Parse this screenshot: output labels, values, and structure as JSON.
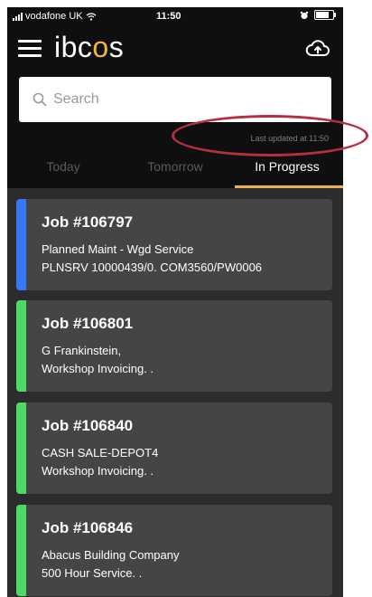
{
  "status_bar": {
    "carrier": "vodafone UK",
    "time": "11:50"
  },
  "header": {
    "brand_prefix": "ibc",
    "brand_accent": "o",
    "brand_suffix": "s",
    "accent_color": "#f0b63f",
    "menu_icon": "hamburger-menu-icon",
    "upload_icon": "cloud-upload-icon"
  },
  "search": {
    "placeholder": "Search",
    "value": ""
  },
  "last_updated": "Last updated at 11:50",
  "tabs": [
    {
      "label": "Today",
      "active": false
    },
    {
      "label": "Tomorrow",
      "active": false
    },
    {
      "label": "In Progress",
      "active": true
    }
  ],
  "jobs": [
    {
      "title": "Job #106797",
      "line1": "Planned Maint - Wgd Service",
      "line2": "PLNSRV 10000439/0. COM3560/PW0006",
      "status_color": "#3478f6"
    },
    {
      "title": "Job #106801",
      "line1": "G Frankinstein,",
      "line2": "Workshop Invoicing. .",
      "status_color": "#4cd964"
    },
    {
      "title": "Job #106840",
      "line1": "CASH SALE-DEPOT4",
      "line2": "Workshop Invoicing. .",
      "status_color": "#4cd964"
    },
    {
      "title": "Job #106846",
      "line1": "Abacus Building Company",
      "line2": "500 Hour Service. .",
      "status_color": "#4cd964"
    }
  ],
  "colors": {
    "header_bg": "#0f0f0f",
    "list_bg": "#2c2c2c",
    "card_bg": "#454545",
    "tab_underline": "#e8b64c",
    "annotation_circle": "#b5303f"
  }
}
